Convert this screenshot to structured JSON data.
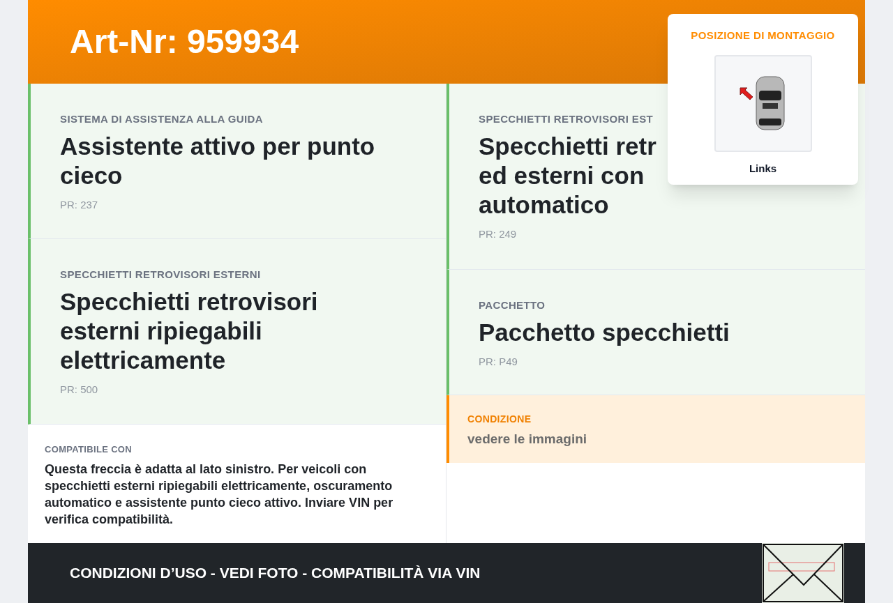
{
  "header": {
    "title": "Art-Nr: 959934"
  },
  "features_left": [
    {
      "category": "SISTEMA DI ASSISTENZA ALLA GUIDA",
      "title_lines": [
        "Assistente attivo per punto",
        "cieco"
      ],
      "code": "PR: 237"
    },
    {
      "category": "SPECCHIETTI RETROVISORI ESTERNI",
      "title_lines": [
        "Specchietti retrovisori",
        "esterni ripiegabili",
        "elettricamente"
      ],
      "code": "PR: 500"
    }
  ],
  "features_right": [
    {
      "category": "SPECCHIETTI RETROVISORI EST",
      "title_lines": [
        "Specchietti retr",
        "ed esterni con",
        "automatico"
      ],
      "code": "PR: 249"
    },
    {
      "category": "PACCHETTO",
      "title_lines": [
        "Pacchetto specchietti"
      ],
      "code": "PR: P49"
    }
  ],
  "compatibility": {
    "label": "COMPATIBILE CON",
    "text": "Questa freccia è adatta al lato sinistro. Per veicoli con specchietti esterni ripiegabili elettricamente, oscuramento automatico e assistente punto cieco attivo. Inviare VIN per verifica compatibilità."
  },
  "condition": {
    "label": "CONDIZIONE",
    "text": "vedere le immagini"
  },
  "mounting": {
    "title": "POSIZIONE DI MONTAGGIO",
    "side": "Links"
  },
  "footer": {
    "text": "CONDIZIONI D’USO - VEDI FOTO - COMPATIBILITÀ VIA VIN"
  }
}
